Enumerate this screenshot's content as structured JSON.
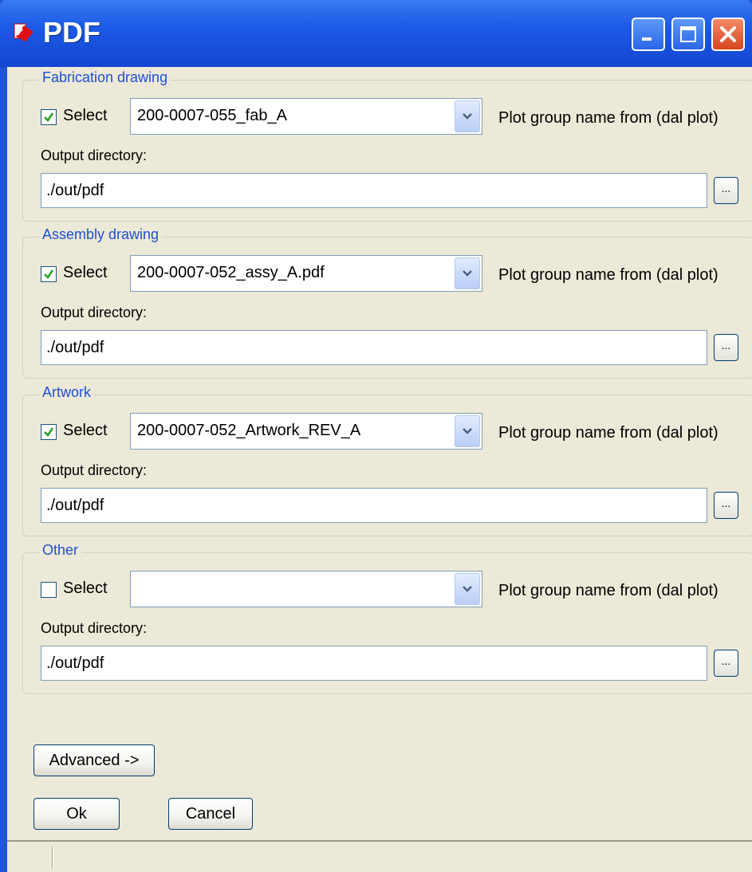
{
  "window": {
    "title": "PDF",
    "colors": {
      "titlebar": "#1c5ae6",
      "client": "#ece9d8",
      "legend": "#1f50d0"
    }
  },
  "icons": [
    "app-icon",
    "minimize-icon",
    "maximize-icon",
    "close-icon",
    "checkmark-icon",
    "chevron-down-icon"
  ],
  "groups": [
    {
      "legend": "Fabrication drawing",
      "checked": true,
      "select_label": "Select",
      "combo_value": "200-0007-055_fab_A",
      "hint": "Plot group name from (dal plot)",
      "output_label": "Output directory:",
      "output_value": "./out/pdf",
      "browse_label": "..."
    },
    {
      "legend": "Assembly drawing",
      "checked": true,
      "select_label": "Select",
      "combo_value": "200-0007-052_assy_A.pdf",
      "hint": "Plot group name from (dal plot)",
      "output_label": "Output directory:",
      "output_value": "./out/pdf",
      "browse_label": "..."
    },
    {
      "legend": "Artwork",
      "checked": true,
      "select_label": "Select",
      "combo_value": "200-0007-052_Artwork_REV_A",
      "hint": "Plot group name from (dal plot)",
      "output_label": "Output directory:",
      "output_value": "./out/pdf",
      "browse_label": "..."
    },
    {
      "legend": "Other",
      "checked": false,
      "select_label": "Select",
      "combo_value": "",
      "hint": "Plot group name from (dal plot)",
      "output_label": "Output directory:",
      "output_value": "./out/pdf",
      "browse_label": "..."
    }
  ],
  "buttons": {
    "advanced": "Advanced ->",
    "ok": "Ok",
    "cancel": "Cancel"
  }
}
